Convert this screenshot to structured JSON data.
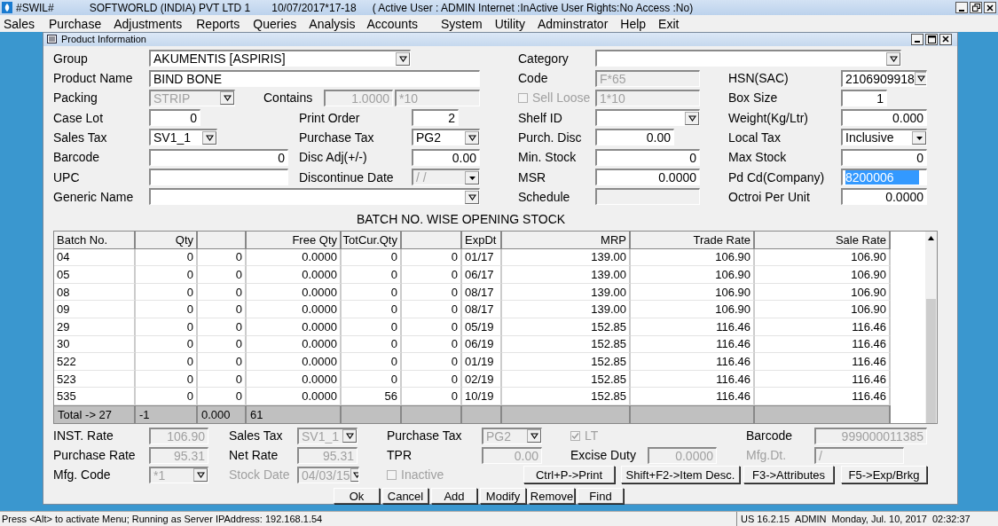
{
  "app_title_bar": {
    "app_name": "#SWIL#",
    "company": "SOFTWORLD (INDIA) PVT LTD 1",
    "date": "10/07/2017*17-18",
    "session": "( Active User : ADMIN Internet :InActive User Rights:No Access :No)"
  },
  "menu": [
    "Sales",
    "Purchase",
    "Adjustments",
    "Reports",
    "Queries",
    "Analysis",
    "Accounts",
    "System",
    "Utility",
    "Adminstrator",
    "Help",
    "Exit"
  ],
  "window": {
    "title": "Product Information"
  },
  "form": {
    "items": [
      {
        "kind": "label",
        "text": "Group",
        "disabled": false
      },
      {
        "kind": "select",
        "value": "AKUMENTIS [ASPIRIS]",
        "disabled": false,
        "highlighted": false
      },
      {
        "kind": "label",
        "text": "Category",
        "disabled": false
      },
      {
        "kind": "select",
        "disabled": false
      },
      {
        "kind": "label",
        "text": "Product Name",
        "disabled": false
      },
      {
        "kind": "input",
        "value": "BIND BONE",
        "disabled": false,
        "highlighted": false
      },
      {
        "kind": "label",
        "text": "Code",
        "disabled": false
      },
      {
        "kind": "input",
        "value": "F*65",
        "disabled": true,
        "highlighted": false
      },
      {
        "kind": "label",
        "text": "HSN(SAC)",
        "disabled": false
      },
      {
        "kind": "select",
        "value": "2106909918",
        "disabled": false,
        "highlighted": false
      },
      {
        "kind": "label",
        "text": "Packing",
        "disabled": false
      },
      {
        "kind": "select",
        "value": "STRIP",
        "disabled": true,
        "highlighted": false
      },
      {
        "kind": "label",
        "text": "Contains",
        "disabled": false
      },
      {
        "kind": "input",
        "value": "1.0000",
        "disabled": true,
        "highlighted": false
      },
      {
        "kind": "input",
        "value": "*10",
        "disabled": true,
        "highlighted": false
      },
      {
        "kind": "checkbox",
        "text": "Sell Loose",
        "checked": false,
        "disabled": true
      },
      {
        "kind": "input",
        "value": "1*10",
        "disabled": true,
        "highlighted": false
      },
      {
        "kind": "label",
        "text": "Box Size",
        "disabled": false
      },
      {
        "kind": "input",
        "value": "1",
        "disabled": false,
        "highlighted": false
      },
      {
        "kind": "label",
        "text": "Case Lot",
        "disabled": false
      },
      {
        "kind": "input",
        "value": "0",
        "disabled": false,
        "highlighted": false
      },
      {
        "kind": "label",
        "text": "Print Order",
        "disabled": false
      },
      {
        "kind": "input",
        "value": "2",
        "disabled": false,
        "highlighted": false
      },
      {
        "kind": "label",
        "text": "Shelf ID",
        "disabled": false
      },
      {
        "kind": "select",
        "disabled": false
      },
      {
        "kind": "label",
        "text": "Weight(Kg/Ltr)",
        "disabled": false
      },
      {
        "kind": "input",
        "value": "0.000",
        "disabled": false,
        "highlighted": false
      },
      {
        "kind": "label",
        "text": "Sales Tax",
        "disabled": false
      },
      {
        "kind": "select",
        "value": "SV1_1",
        "disabled": false,
        "highlighted": false
      },
      {
        "kind": "label",
        "text": "Purchase Tax",
        "disabled": false
      },
      {
        "kind": "select",
        "value": "PG2",
        "disabled": false,
        "highlighted": false
      },
      {
        "kind": "label",
        "text": "Purch. Disc",
        "disabled": false
      },
      {
        "kind": "input",
        "value": "0.00",
        "disabled": false,
        "highlighted": false
      },
      {
        "kind": "label",
        "text": "Local Tax",
        "disabled": false
      },
      {
        "kind": "combo",
        "value": "Inclusive",
        "disabled": false,
        "highlighted": false
      },
      {
        "kind": "label",
        "text": "Barcode",
        "disabled": false
      },
      {
        "kind": "input",
        "value": "0",
        "disabled": false,
        "highlighted": false
      },
      {
        "kind": "label",
        "text": "Disc Adj(+/-)",
        "disabled": false
      },
      {
        "kind": "input",
        "value": "0.00",
        "disabled": false,
        "highlighted": false
      },
      {
        "kind": "label",
        "text": "Min. Stock",
        "disabled": false
      },
      {
        "kind": "input",
        "value": "0",
        "disabled": false,
        "highlighted": false
      },
      {
        "kind": "label",
        "text": "Max Stock",
        "disabled": false
      },
      {
        "kind": "input",
        "value": "0",
        "disabled": false,
        "highlighted": false
      },
      {
        "kind": "label",
        "text": "UPC",
        "disabled": false
      },
      {
        "kind": "input",
        "disabled": false
      },
      {
        "kind": "label",
        "text": "Discontinue Date",
        "disabled": false
      },
      {
        "kind": "combo",
        "value": "/ /",
        "disabled": true,
        "highlighted": false
      },
      {
        "kind": "label",
        "text": "MSR",
        "disabled": false
      },
      {
        "kind": "input",
        "value": "0.0000",
        "disabled": false,
        "highlighted": false
      },
      {
        "kind": "label",
        "text": "Pd Cd(Company)",
        "disabled": false
      },
      {
        "kind": "input",
        "value": "8200006",
        "disabled": false,
        "highlighted": true
      },
      {
        "kind": "label",
        "text": "Generic Name",
        "disabled": false
      },
      {
        "kind": "select",
        "disabled": false
      },
      {
        "kind": "label",
        "text": "Schedule",
        "disabled": false
      },
      {
        "kind": "input",
        "disabled": true
      },
      {
        "kind": "label",
        "text": "Octroi Per Unit",
        "disabled": false
      },
      {
        "kind": "input",
        "value": "0.0000",
        "disabled": false,
        "highlighted": false
      }
    ]
  },
  "table": {
    "title": "BATCH NO. WISE OPENING STOCK",
    "columns": [
      "Batch No.",
      "Qty",
      null,
      "Free Qty",
      "TotCur.Qty",
      null,
      "ExpDt",
      "MRP",
      "Trade Rate",
      "Sale Rate"
    ],
    "rows": [
      [
        "04",
        "0",
        "0",
        "0.0000",
        "0",
        "0",
        "01/17",
        "139.00",
        "106.90",
        "106.90"
      ],
      [
        "05",
        "0",
        "0",
        "0.0000",
        "0",
        "0",
        "06/17",
        "139.00",
        "106.90",
        "106.90"
      ],
      [
        "08",
        "0",
        "0",
        "0.0000",
        "0",
        "0",
        "08/17",
        "139.00",
        "106.90",
        "106.90"
      ],
      [
        "09",
        "0",
        "0",
        "0.0000",
        "0",
        "0",
        "08/17",
        "139.00",
        "106.90",
        "106.90"
      ],
      [
        "29",
        "0",
        "0",
        "0.0000",
        "0",
        "0",
        "05/19",
        "152.85",
        "116.46",
        "116.46"
      ],
      [
        "30",
        "0",
        "0",
        "0.0000",
        "0",
        "0",
        "06/19",
        "152.85",
        "116.46",
        "116.46"
      ],
      [
        "522",
        "0",
        "0",
        "0.0000",
        "0",
        "0",
        "01/19",
        "152.85",
        "116.46",
        "116.46"
      ],
      [
        "523",
        "0",
        "0",
        "0.0000",
        "0",
        "0",
        "02/19",
        "152.85",
        "116.46",
        "116.46"
      ],
      [
        "535",
        "0",
        "0",
        "0.0000",
        "56",
        "0",
        "10/19",
        "152.85",
        "116.46",
        "116.46"
      ]
    ],
    "total": [
      "Total ->  27",
      "-1",
      "0.000",
      "61"
    ]
  },
  "details": {
    "items": [
      {
        "kind": "label",
        "text": "INST. Rate",
        "disabled": false
      },
      {
        "kind": "input",
        "value": "106.90",
        "disabled": true
      },
      {
        "kind": "label",
        "text": "Sales Tax",
        "disabled": false
      },
      {
        "kind": "select",
        "value": "SV1_1",
        "disabled": true
      },
      {
        "kind": "label",
        "text": "Purchase Tax",
        "disabled": false
      },
      {
        "kind": "select",
        "value": "PG2",
        "disabled": true
      },
      {
        "kind": "checkbox",
        "text": "LT",
        "checked": true,
        "disabled": true
      },
      {
        "kind": "label",
        "text": "Barcode",
        "disabled": false
      },
      {
        "kind": "input",
        "value": "999000011385",
        "disabled": true
      },
      {
        "kind": "label",
        "text": "Purchase Rate",
        "disabled": false
      },
      {
        "kind": "input",
        "value": "95.31",
        "disabled": true
      },
      {
        "kind": "label",
        "text": "Net Rate",
        "disabled": false
      },
      {
        "kind": "input",
        "value": "95.31",
        "disabled": true
      },
      {
        "kind": "label",
        "text": "TPR",
        "disabled": false
      },
      {
        "kind": "input",
        "value": "0.00",
        "disabled": true
      },
      {
        "kind": "label",
        "text": "Excise Duty",
        "disabled": false
      },
      {
        "kind": "input",
        "value": "0.0000",
        "disabled": true
      },
      {
        "kind": "label",
        "text": "Mfg.Dt.",
        "disabled": true
      },
      {
        "kind": "input",
        "value": "/",
        "disabled": true
      },
      {
        "kind": "label",
        "text": "Mfg. Code",
        "disabled": false
      },
      {
        "kind": "select",
        "value": "*1",
        "disabled": true
      },
      {
        "kind": "label",
        "text": "Stock Date",
        "disabled": true
      },
      {
        "kind": "select",
        "value": "04/03/15",
        "disabled": true
      },
      {
        "kind": "checkbox",
        "text": "Inactive",
        "checked": false,
        "disabled": true
      },
      {
        "kind": "button",
        "text": "Ctrl+P->Print",
        "disabled": false
      },
      {
        "kind": "button",
        "text": "Shift+F2->Item Desc.",
        "disabled": false
      },
      {
        "kind": "button",
        "text": "F3->Attributes",
        "disabled": false
      },
      {
        "kind": "button",
        "text": "F5->Exp/Brkg",
        "disabled": false
      }
    ]
  },
  "actions": [
    "Ok",
    "Cancel",
    "Add",
    "Modify",
    "Remove",
    "Find"
  ],
  "status_bar": {
    "message": "Press <Alt> to activate Menu; Running as Server IPAddress: 192.168.1.54",
    "version": "US 16.2.15",
    "user": "ADMIN",
    "date": "Monday, Jul. 10, 2017",
    "time": "02:32:37"
  }
}
